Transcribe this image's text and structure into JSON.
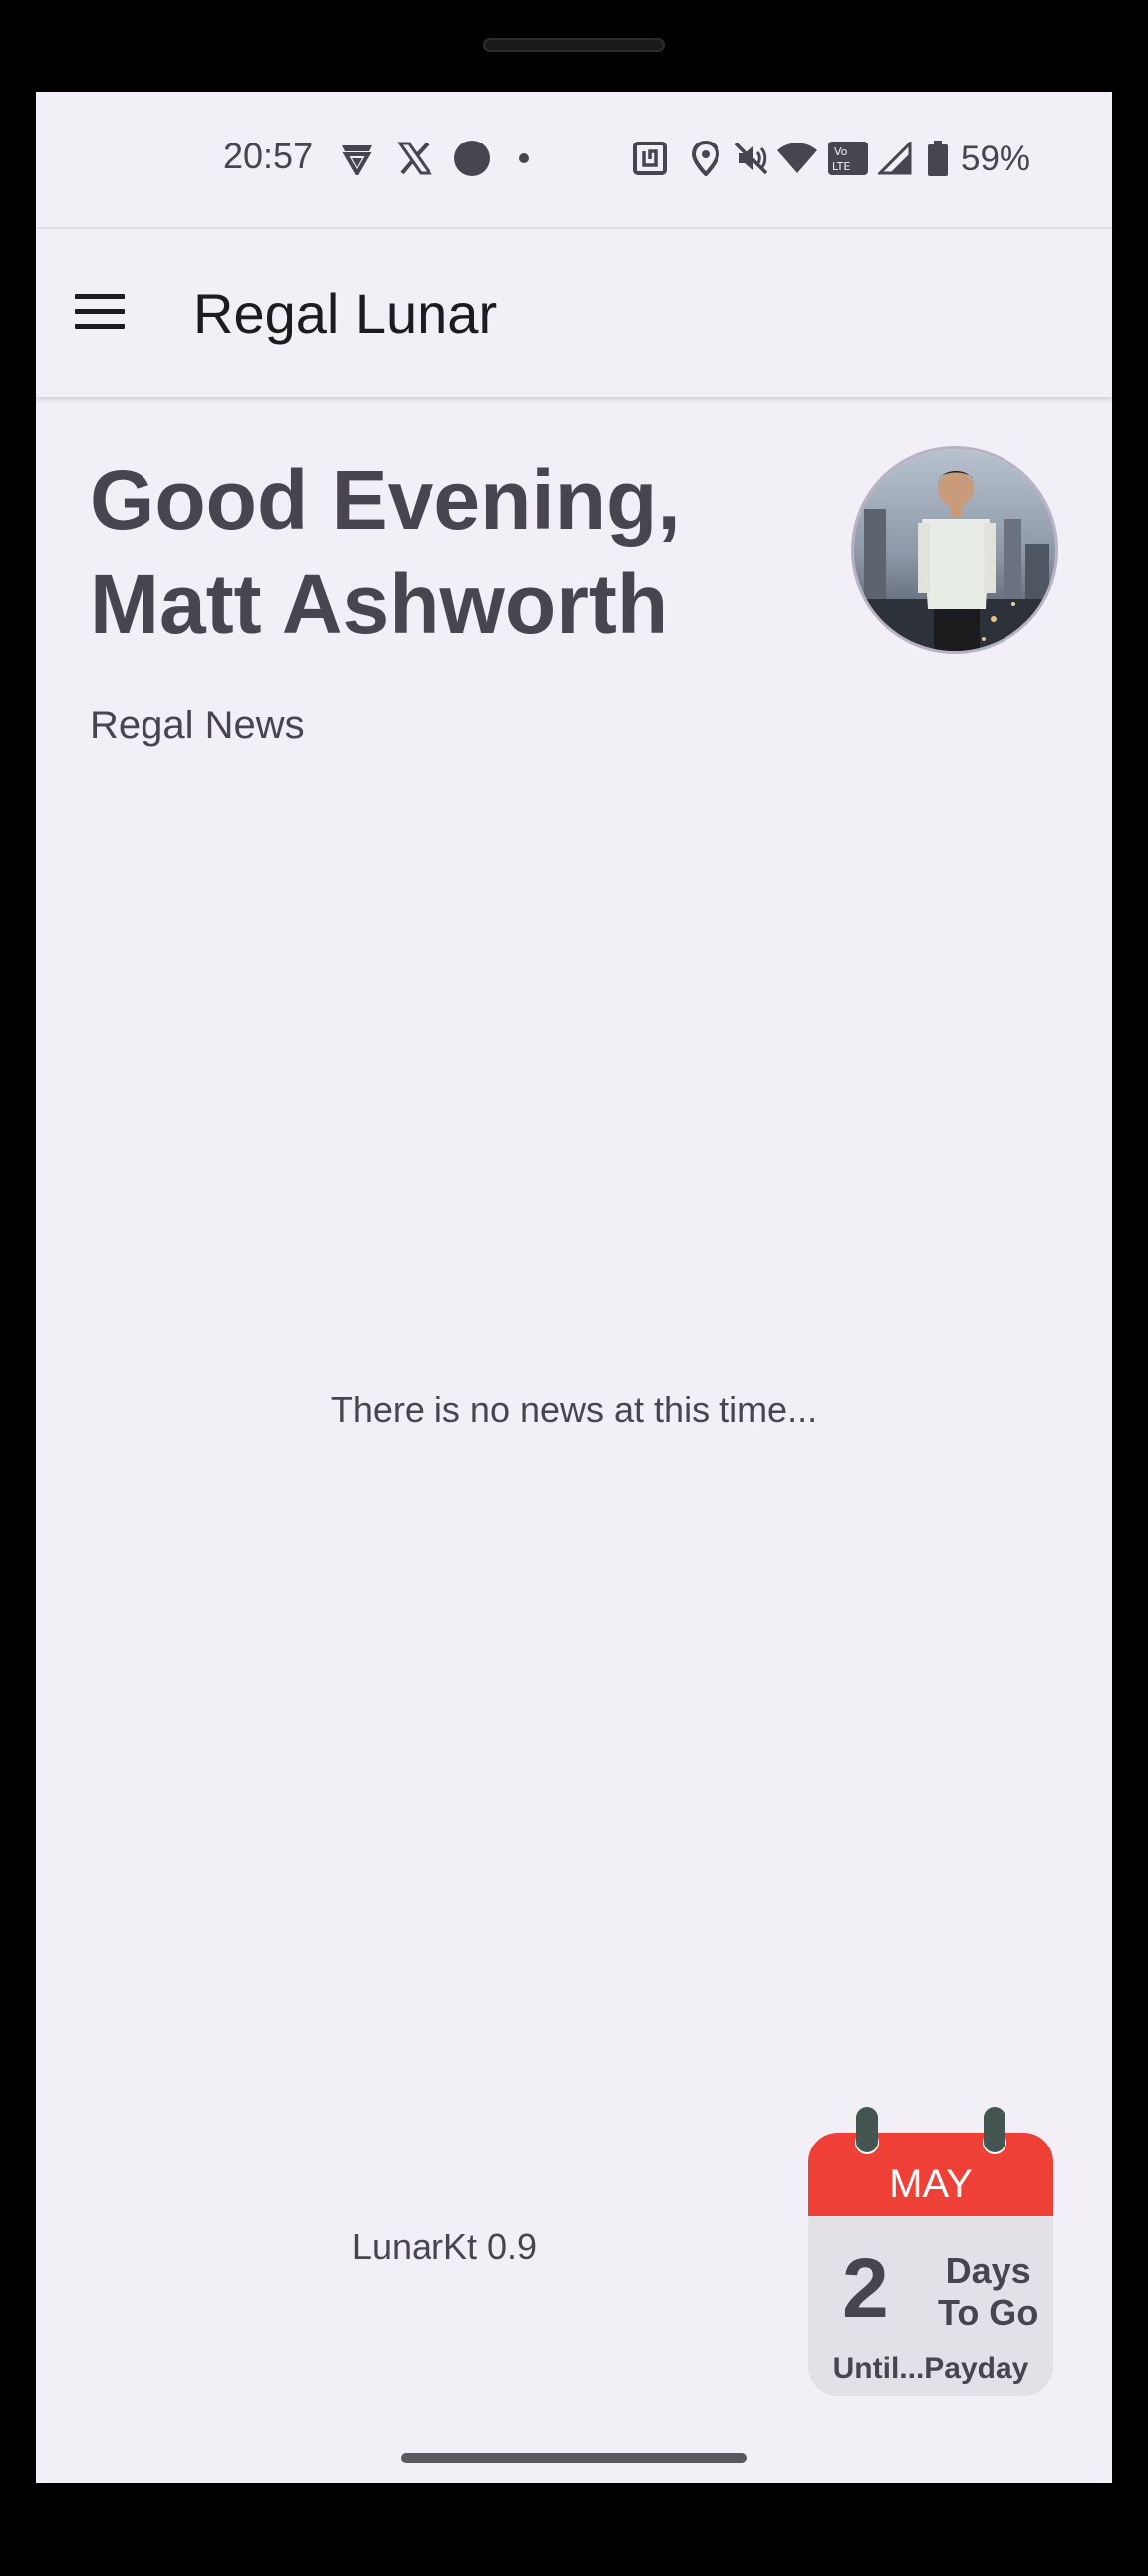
{
  "status_bar": {
    "time": "20:57",
    "battery": "59%",
    "icons": [
      "shield-v-icon",
      "x-logo-icon",
      "dot-filled-icon",
      "dot-small-icon",
      "nfc-icon",
      "location-icon",
      "mute-icon",
      "wifi-icon",
      "volte-icon",
      "signal-icon",
      "battery-icon"
    ],
    "volte_label": "Vo\nLTE"
  },
  "app_bar": {
    "title": "Regal Lunar",
    "menu_icon": "hamburger-menu-icon"
  },
  "greeting": {
    "line1": "Good Evening,",
    "line2": "Matt Ashworth"
  },
  "news": {
    "section_label": "Regal News",
    "empty_message": "There is no news at this time..."
  },
  "footer": {
    "version": "LunarKt 0.9"
  },
  "payday_widget": {
    "month": "MAY",
    "days_count": "2",
    "days_line1": "Days",
    "days_line2": "To Go",
    "caption": "Until...Payday",
    "accent_color": "#ee4036"
  },
  "colors": {
    "background": "#f3eff7",
    "text": "#49454f",
    "title_text": "#1d1b20"
  }
}
